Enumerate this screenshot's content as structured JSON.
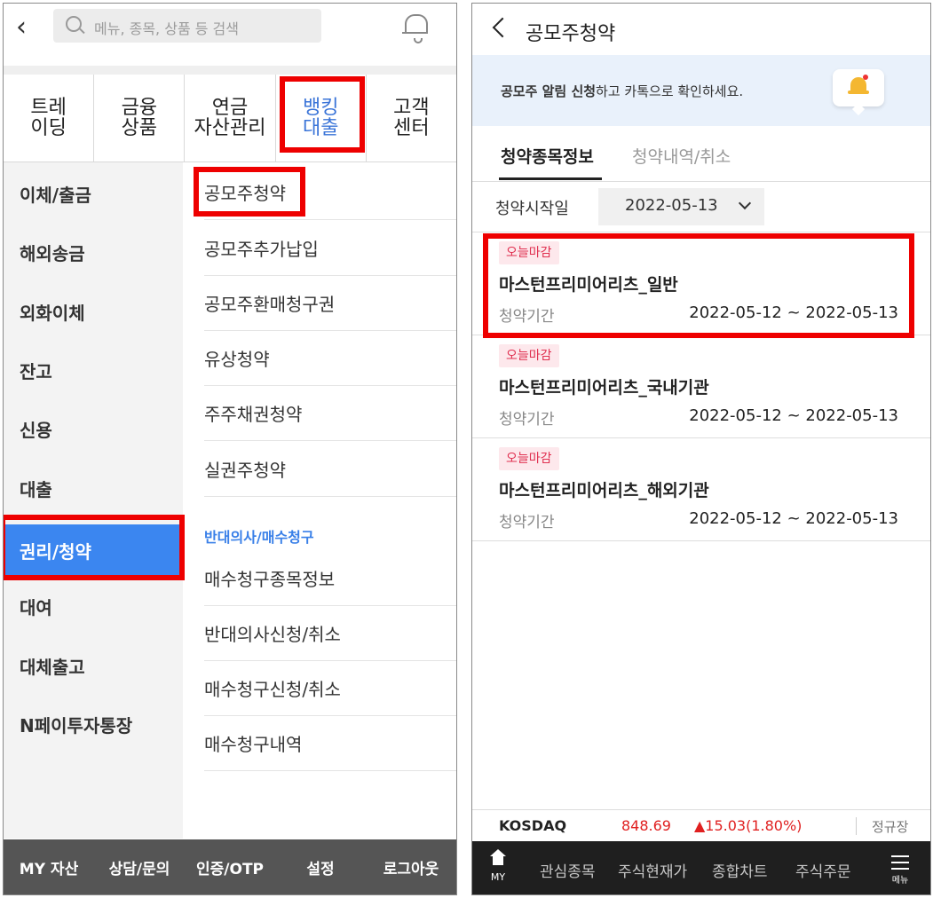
{
  "left": {
    "back_icon": "chevron-left",
    "search_placeholder": "메뉴, 종목, 상품 등 검색",
    "top_tabs": [
      {
        "label": "트레\n이딩"
      },
      {
        "label": "금융\n상품"
      },
      {
        "label": "연금\n자산관리"
      },
      {
        "label": "뱅킹\n대출"
      },
      {
        "label": "고객\n센터"
      }
    ],
    "active_top_tab": "뱅킹 대출",
    "side_items": [
      {
        "label": "이체/출금"
      },
      {
        "label": "해외송금"
      },
      {
        "label": "외화이체"
      },
      {
        "label": "잔고"
      },
      {
        "label": "신용"
      },
      {
        "label": "대출"
      },
      {
        "label": "권리/청약"
      },
      {
        "label": "대여"
      },
      {
        "label": "대체출고"
      },
      {
        "label": "N페이투자통장"
      }
    ],
    "active_side_item": "권리/청약",
    "sub_items": [
      {
        "label": "공모주청약"
      },
      {
        "label": "공모주추가납입"
      },
      {
        "label": "공모주환매청구권"
      },
      {
        "label": "유상청약"
      },
      {
        "label": "주주채권청약"
      },
      {
        "label": "실권주청약"
      }
    ],
    "sub_section_header": "반대의사/매수청구",
    "sub_items_2": [
      {
        "label": "매수청구종목정보"
      },
      {
        "label": "반대의사신청/취소"
      },
      {
        "label": "매수청구신청/취소"
      },
      {
        "label": "매수청구내역"
      }
    ],
    "bottom_bar": [
      {
        "label": "MY 자산"
      },
      {
        "label": "상담/문의"
      },
      {
        "label": "인증/OTP"
      },
      {
        "label": "설정"
      },
      {
        "label": "로그아웃"
      }
    ]
  },
  "right": {
    "title": "공모주청약",
    "banner": {
      "bold": "공모주 알림 신청",
      "rest": "하고 카톡으로 확인하세요."
    },
    "tabs": [
      {
        "label": "청약종목정보"
      },
      {
        "label": "청약내역/취소"
      }
    ],
    "active_tab": "청약종목정보",
    "filter": {
      "label": "청약시작일",
      "value": "2022-05-13"
    },
    "cards": [
      {
        "badge": "오늘마감",
        "name": "마스턴프리미어리츠_일반",
        "period_label": "청약기간",
        "period": "2022-05-12 ~ 2022-05-13"
      },
      {
        "badge": "오늘마감",
        "name": "마스턴프리미어리츠_국내기관",
        "period_label": "청약기간",
        "period": "2022-05-12 ~ 2022-05-13"
      },
      {
        "badge": "오늘마감",
        "name": "마스턴프리미어리츠_해외기관",
        "period_label": "청약기간",
        "period": "2022-05-12 ~ 2022-05-13"
      }
    ],
    "ticker": {
      "name": "KOSDAQ",
      "price": "848.69",
      "change": "▲15.03(1.80%)",
      "market": "정규장"
    },
    "nav": {
      "my": "MY",
      "items": [
        {
          "label": "관심종목"
        },
        {
          "label": "주식현재가"
        },
        {
          "label": "종합차트"
        },
        {
          "label": "주식주문"
        }
      ],
      "menu": "메뉴"
    },
    "colors": {
      "highlight": "#ee0000",
      "accent": "#3b86f0",
      "badge_bg": "#fde8ec",
      "badge_text": "#e03050"
    }
  }
}
